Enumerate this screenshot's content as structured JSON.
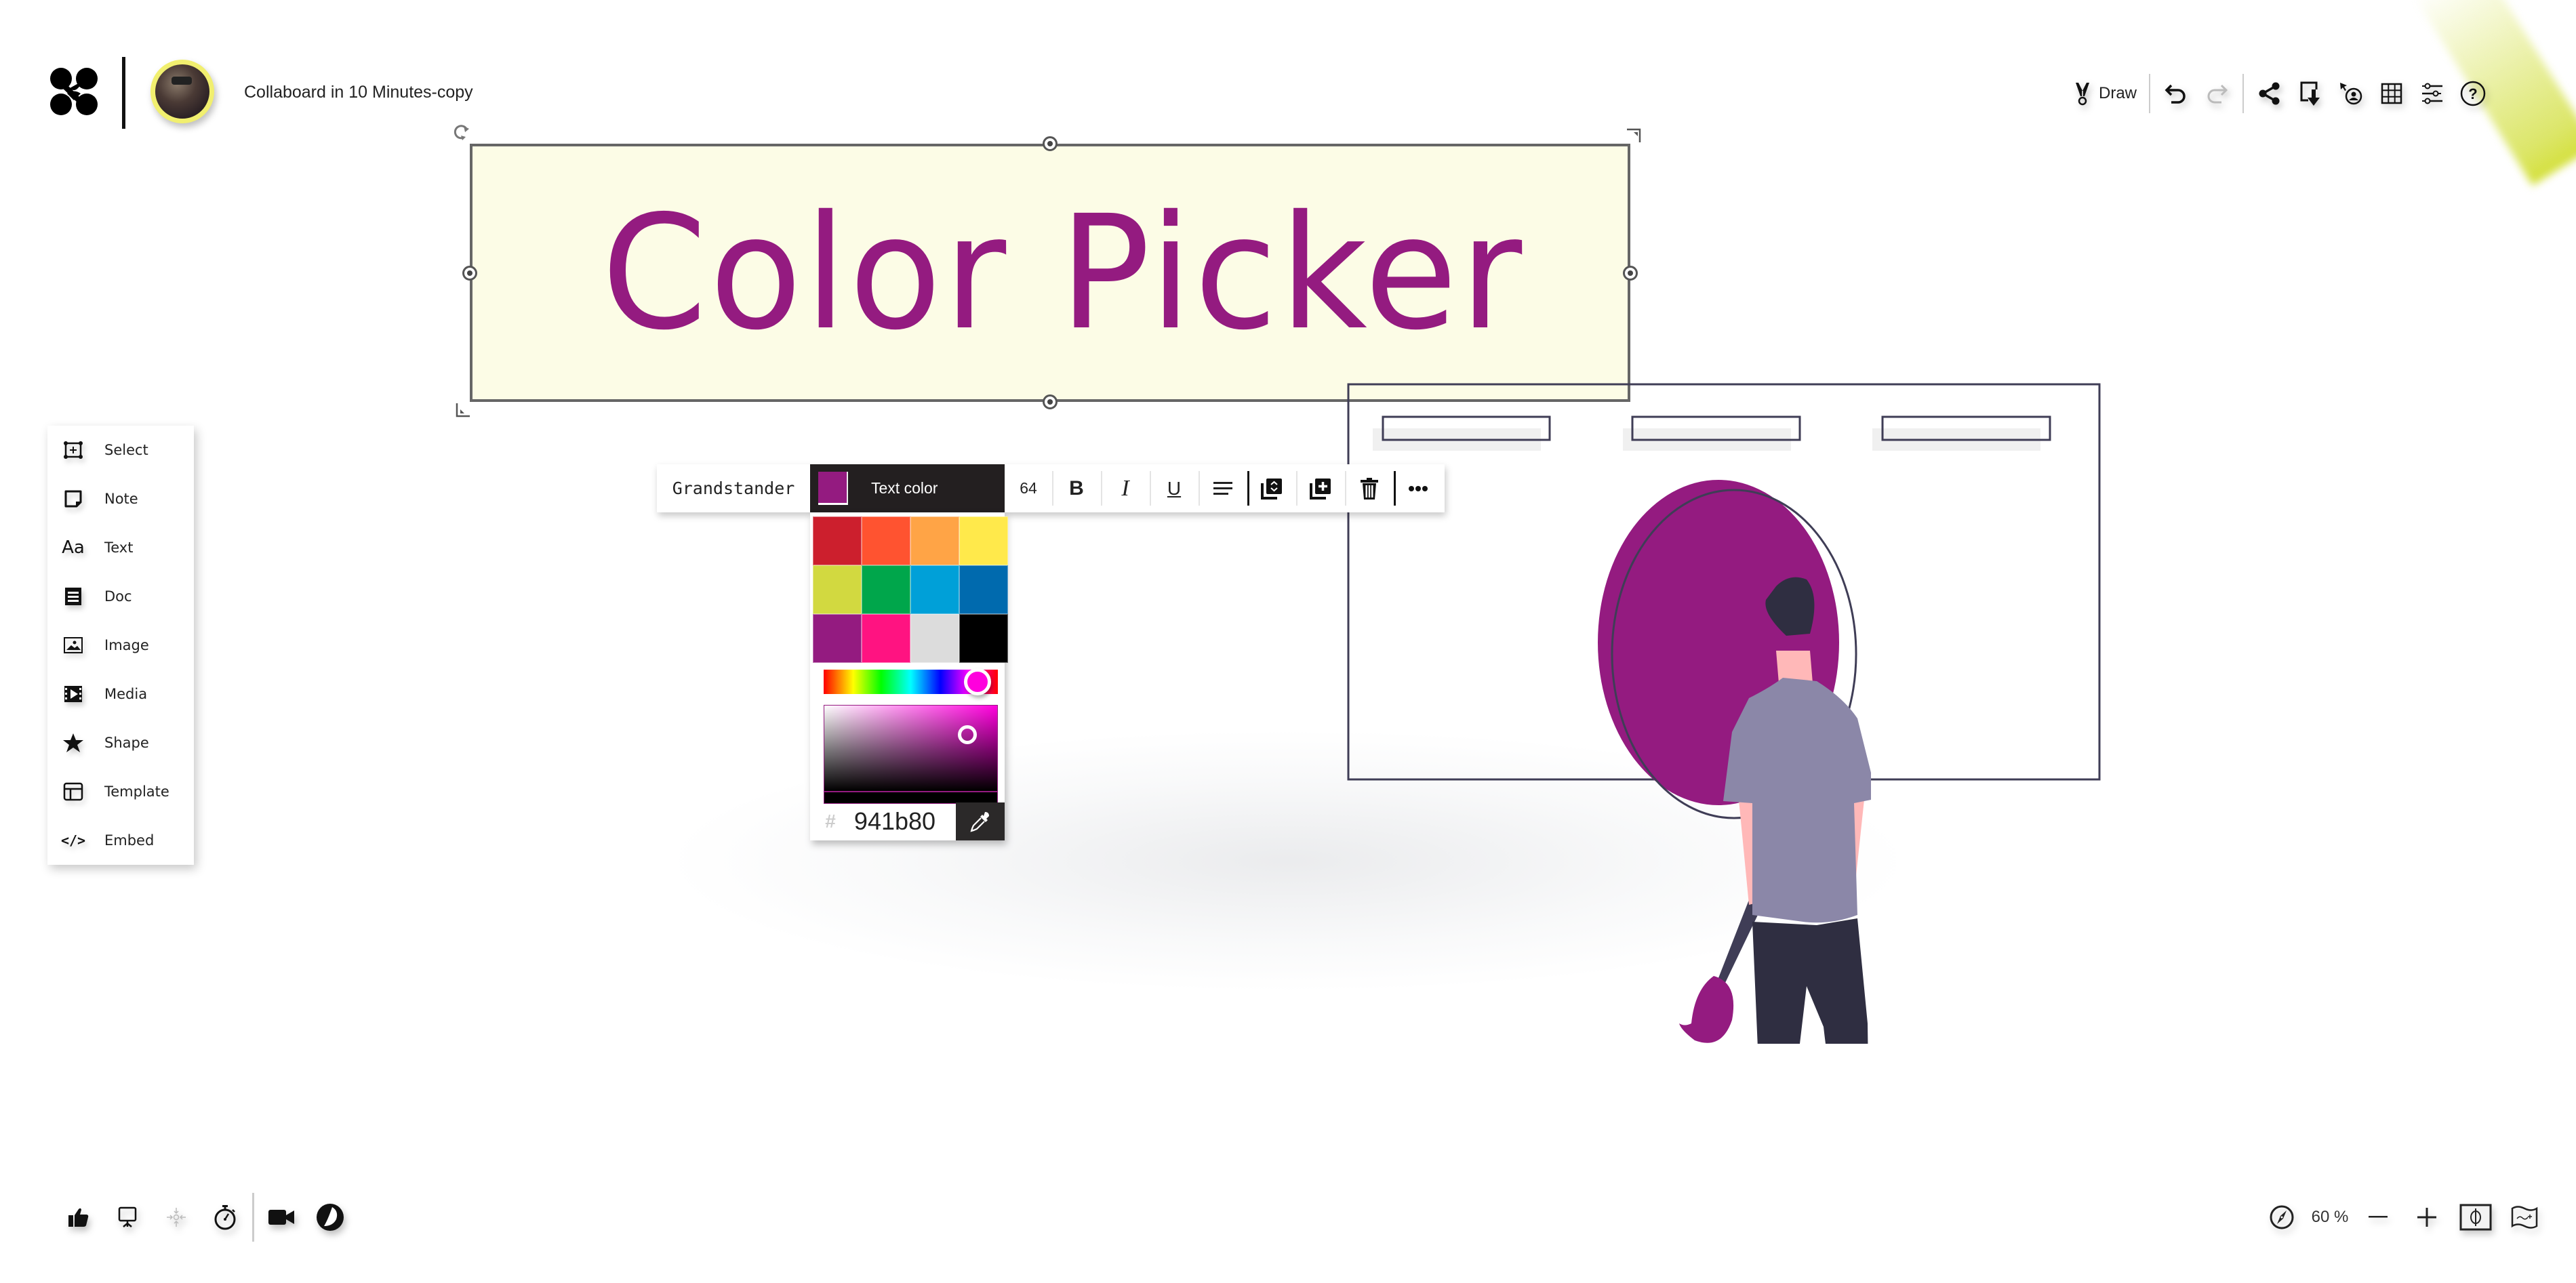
{
  "header": {
    "logo_icon": "collaboard-logo-icon",
    "avatar_icon": "user-avatar",
    "board_title": "Collaboard in 10 Minutes-copy"
  },
  "top_toolbar": {
    "draw_label": "Draw",
    "items": [
      {
        "icon": "pen-nib-icon",
        "label": "Draw"
      },
      {
        "icon": "undo-icon",
        "enabled": true
      },
      {
        "icon": "redo-icon",
        "enabled": false
      },
      {
        "icon": "share-icon"
      },
      {
        "icon": "export-icon"
      },
      {
        "icon": "follow-user-icon"
      },
      {
        "icon": "grid-icon"
      },
      {
        "icon": "settings-sliders-icon"
      },
      {
        "icon": "help-icon"
      }
    ]
  },
  "tools": {
    "items": [
      {
        "label": "Select",
        "icon": "select-icon"
      },
      {
        "label": "Note",
        "icon": "note-icon"
      },
      {
        "label": "Text",
        "icon": "text-icon",
        "glyph": "Aa"
      },
      {
        "label": "Doc",
        "icon": "doc-icon"
      },
      {
        "label": "Image",
        "icon": "image-icon"
      },
      {
        "label": "Media",
        "icon": "media-icon"
      },
      {
        "label": "Shape",
        "icon": "star-icon"
      },
      {
        "label": "Template",
        "icon": "template-icon"
      },
      {
        "label": "Embed",
        "icon": "embed-icon",
        "glyph": "</>"
      }
    ]
  },
  "selected_text": {
    "content": "Color Picker",
    "color": "#941b80",
    "background": "#fcfce6"
  },
  "format_toolbar": {
    "font_family": "Grandstander",
    "text_color_label": "Text color",
    "text_color": "#941b80",
    "font_size": "64",
    "bold_label": "B",
    "italic_label": "I",
    "underline_label": "U",
    "actions": [
      "align-icon",
      "arrange-icon",
      "duplicate-icon",
      "delete-icon",
      "more-icon"
    ]
  },
  "color_picker": {
    "presets": [
      "#cc1f2d",
      "#ff5330",
      "#ffa446",
      "#ffe94b",
      "#d2d940",
      "#00a64b",
      "#00a0d8",
      "#006aae",
      "#941b80",
      "#ff1381",
      "#dcdcdc",
      "#000000"
    ],
    "hue_color": "#ff00dd",
    "hex_prefix": "#",
    "hex_value": "941b80",
    "eyedropper_icon": "eyedropper-icon"
  },
  "bottom_left_toolbar": {
    "items": [
      "thumbs-up-icon",
      "presentation-icon",
      "focus-icon",
      "timer-icon",
      "video-call-icon",
      "theme-toggle-icon"
    ]
  },
  "bottom_right_toolbar": {
    "zoom_level": "60 %",
    "items": [
      "navigator-icon",
      "zoom-out-icon",
      "zoom-in-icon",
      "fit-to-screen-icon",
      "minimap-icon"
    ]
  },
  "illustration": {
    "accent": "#941b80",
    "dark": "#2f2e41",
    "shirt": "#8b87a8",
    "skin": "#ffb8b8"
  }
}
